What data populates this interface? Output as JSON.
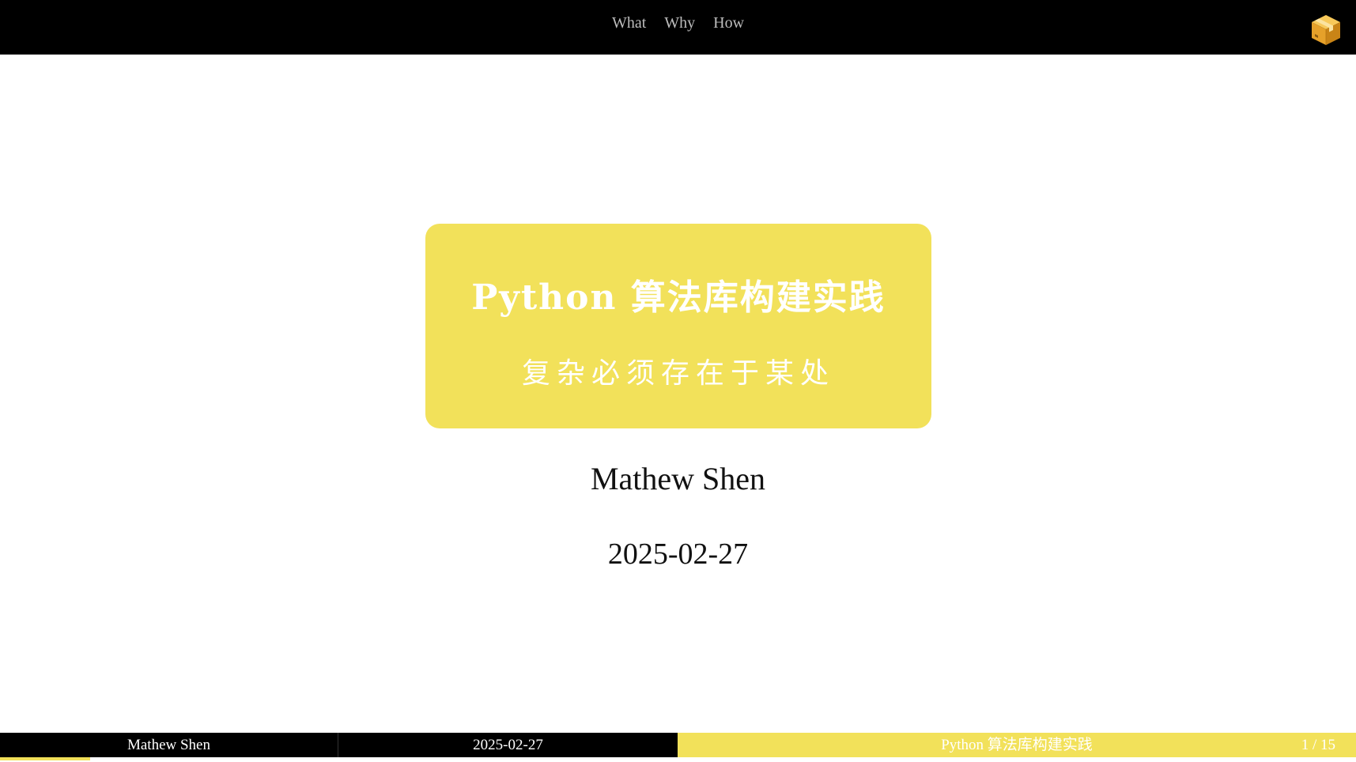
{
  "nav": {
    "items": [
      "What",
      "Why",
      "How"
    ]
  },
  "logo": {
    "icon": "package-box-icon"
  },
  "slide": {
    "title": "Python 算法库构建实践",
    "subtitle": "复杂必须存在于某处",
    "author": "Mathew Shen",
    "date": "2025-02-27"
  },
  "footer": {
    "author": "Mathew Shen",
    "date": "2025-02-27",
    "title": "Python 算法库构建实践",
    "page": "1 / 15"
  },
  "progress": {
    "current": 1,
    "total": 15
  },
  "colors": {
    "accent": "#f2e15a",
    "bar": "#000000"
  }
}
